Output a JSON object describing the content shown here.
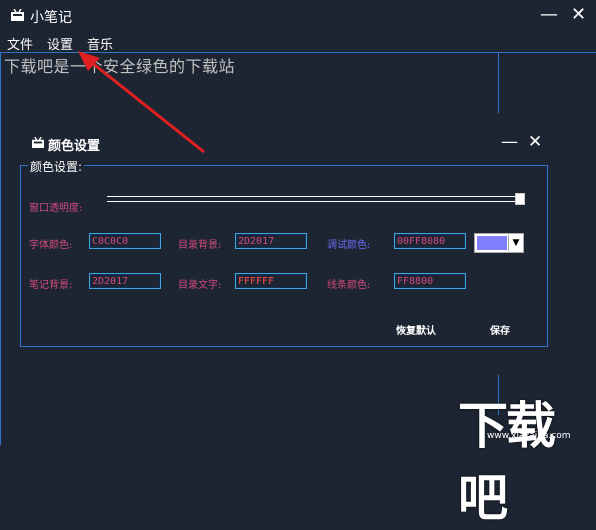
{
  "window": {
    "title": "小笔记",
    "minimize_symbol": "—",
    "close_symbol": "✕"
  },
  "menu": {
    "file": "文件",
    "settings": "设置",
    "music": "音乐"
  },
  "editor": {
    "text": "下载吧是一个安全绿色的下载站"
  },
  "dialog": {
    "title": "颜色设置",
    "minimize_symbol": "—",
    "close_symbol": "✕",
    "group_label": "颜色设置:",
    "opacity_label": "窗口透明度:",
    "opacity_value": 1.0,
    "font_color_label": "字体颜色:",
    "font_color_value": "C0C0C0",
    "dir_bg_label": "目录背景:",
    "dir_bg_value": "2D2017",
    "debug_color_label": "调试颜色:",
    "debug_color_value": "00FF8080",
    "note_bg_label": "笔记背景:",
    "note_bg_value": "2D2017",
    "dir_text_label": "目录文字:",
    "dir_text_value": "FFFFFF",
    "line_color_label": "线条颜色:",
    "line_color_value": "FF8800",
    "swatch_color": "#8080ff",
    "restore_default": "恢复默认",
    "save": "保存"
  },
  "watermark": {
    "text": "下载吧",
    "url": "www.xiazaiba.com"
  },
  "colors": {
    "background": "#1d2533",
    "accent_line": "#2f74c9",
    "label_pink": "#d14a7c",
    "label_blue": "#6a6af2",
    "arrow_red": "#e02020"
  }
}
